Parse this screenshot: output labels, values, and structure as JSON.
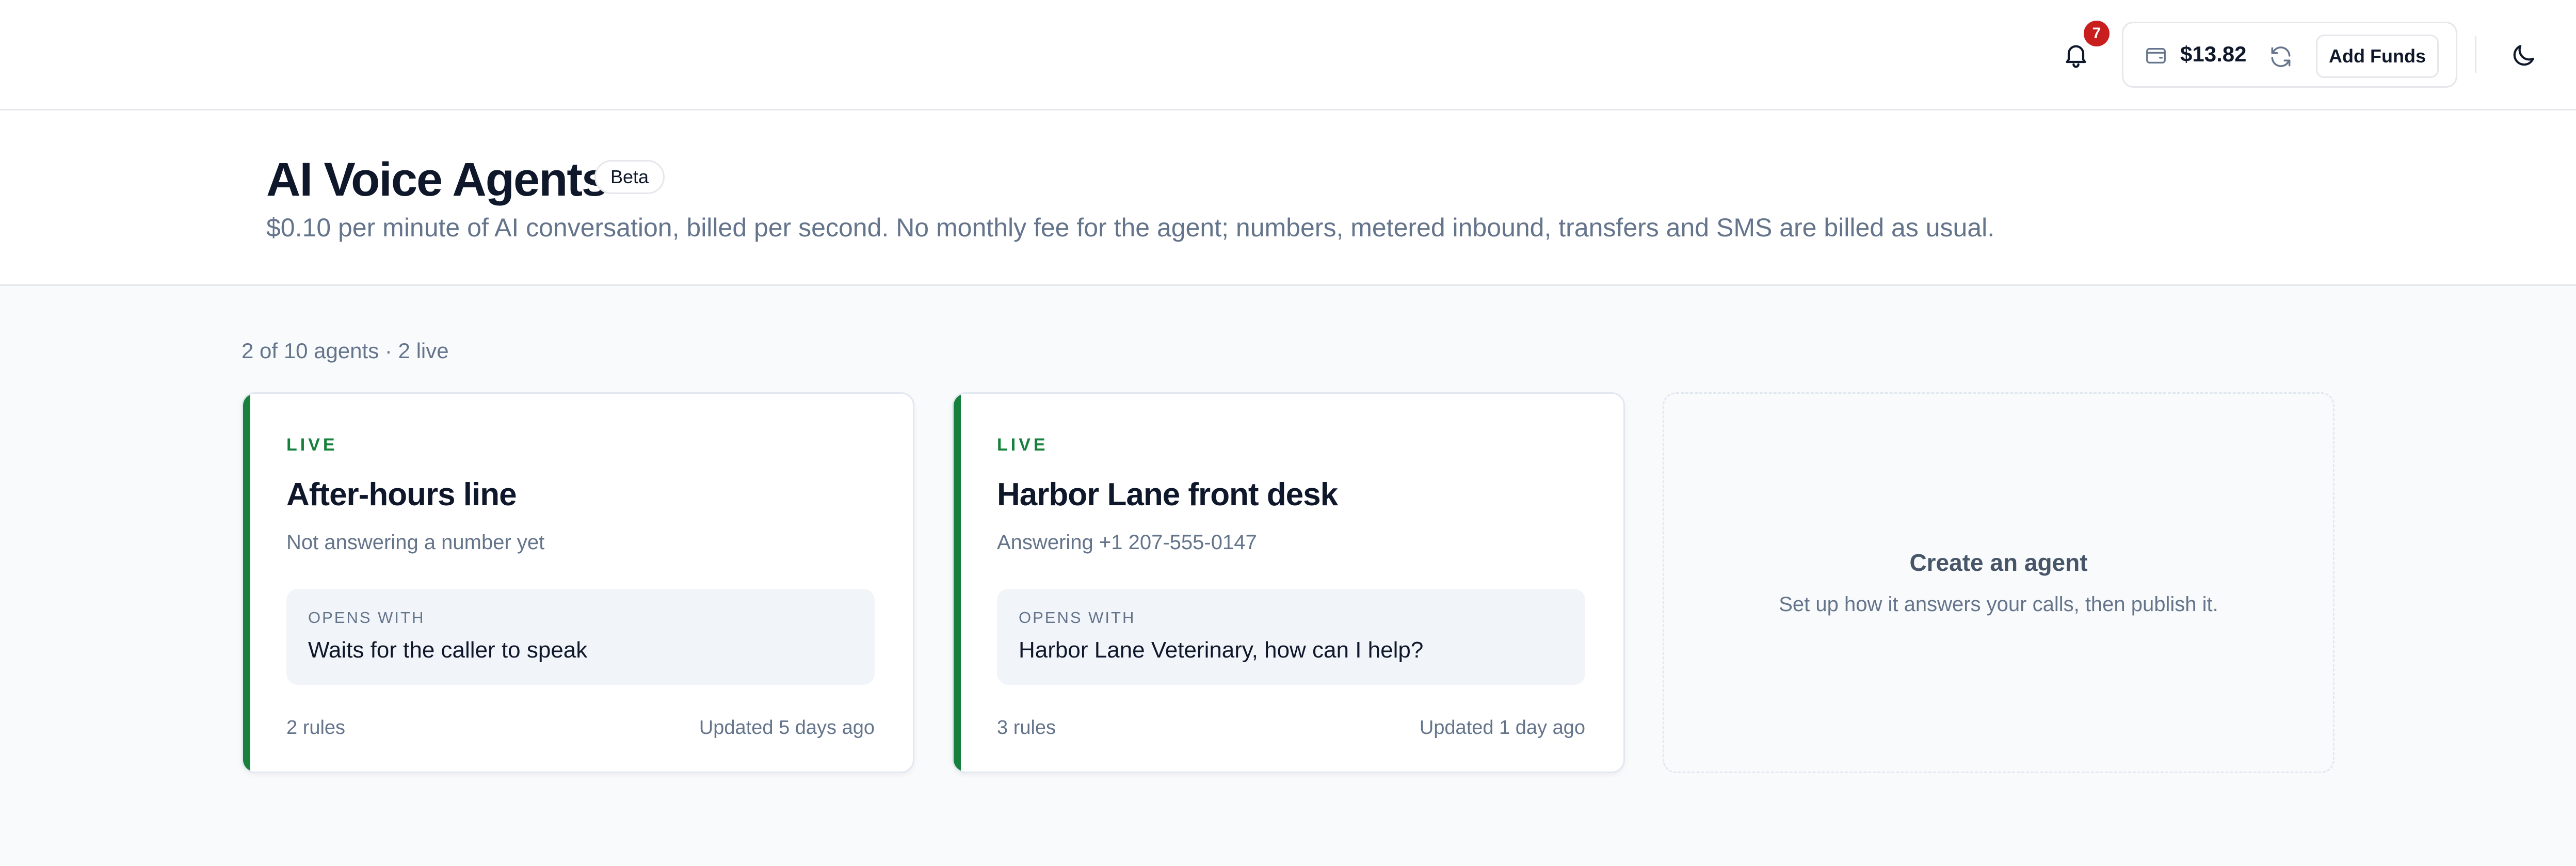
{
  "topbar": {
    "notifications_count": "7",
    "balance": "$13.82",
    "add_funds_label": "Add Funds"
  },
  "header": {
    "title": "AI Voice Agents",
    "badge": "Beta",
    "subtitle": "$0.10 per minute of AI conversation, billed per second. No monthly fee for the agent; numbers, metered inbound, transfers and SMS are billed as usual."
  },
  "summary": "2 of 10 agents · 2 live",
  "agents": [
    {
      "status": "LIVE",
      "name": "After-hours line",
      "number_status": "Not answering a number yet",
      "opens_with_label": "OPENS WITH",
      "opens_with": "Waits for the caller to speak",
      "rules": "2 rules",
      "updated": "Updated 5 days ago"
    },
    {
      "status": "LIVE",
      "name": "Harbor Lane front desk",
      "number_status": "Answering +1 207-555-0147",
      "opens_with_label": "OPENS WITH",
      "opens_with": "Harbor Lane Veterinary, how can I help?",
      "rules": "3 rules",
      "updated": "Updated 1 day ago"
    }
  ],
  "create_card": {
    "title": "Create an agent",
    "subtitle": "Set up how it answers your calls, then publish it."
  },
  "colors": {
    "live_accent": "#16803c",
    "notification_badge": "#c81e1e",
    "muted_text": "#64748b"
  },
  "icons": [
    "bell-icon",
    "wallet-icon",
    "refresh-icon",
    "moon-icon"
  ]
}
